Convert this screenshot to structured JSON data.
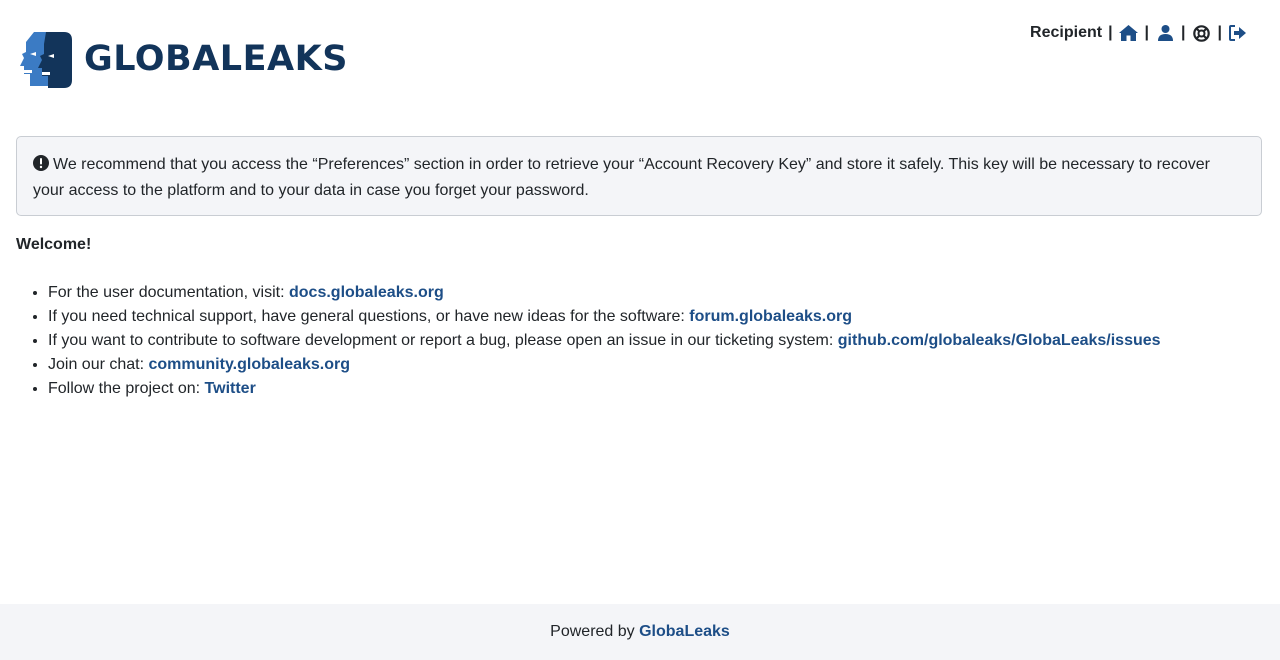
{
  "brand": {
    "name": "GLOBALEAKS",
    "icon": "globaleaks-logo-icon",
    "colors": {
      "dark": "#12345a",
      "light": "#3b7bc4",
      "link": "#1d4e87"
    }
  },
  "topnav": {
    "role": "Recipient",
    "separator": "|",
    "icons": [
      "home-icon",
      "user-icon",
      "lifebuoy-icon",
      "logout-icon"
    ]
  },
  "alert": {
    "icon": "exclamation-circle-icon",
    "text": "We recommend that you access the “Preferences” section in order to retrieve your “Account Recovery Key” and store it safely. This key will be necessary to recover your access to the platform and to your data in case you forget your password."
  },
  "welcome": {
    "title": "Welcome!",
    "items": [
      {
        "text": "For the user documentation, visit: ",
        "link": "docs.globaleaks.org"
      },
      {
        "text": "If you need technical support, have general questions, or have new ideas for the software: ",
        "link": "forum.globaleaks.org"
      },
      {
        "text": "If you want to contribute to software development or report a bug, please open an issue in our ticketing system: ",
        "link": "github.com/globaleaks/GlobaLeaks/issues"
      },
      {
        "text": "Join our chat: ",
        "link": "community.globaleaks.org"
      },
      {
        "text": "Follow the project on: ",
        "link": "Twitter"
      }
    ]
  },
  "footer": {
    "prefix": "Powered by ",
    "link": "GlobaLeaks"
  }
}
